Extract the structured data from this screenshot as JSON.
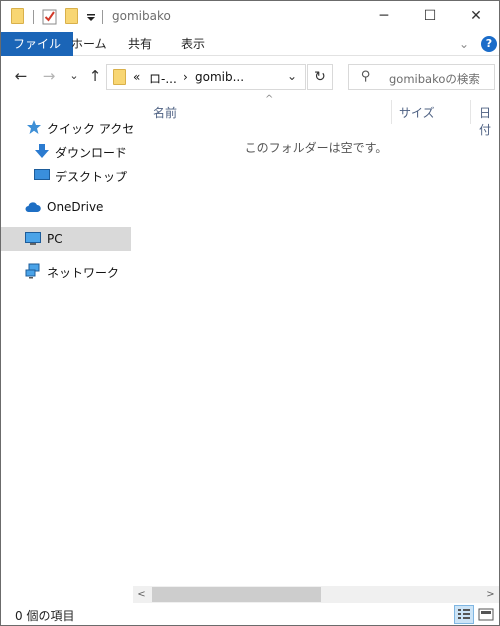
{
  "window": {
    "title": "gomibako",
    "minimize_glyph": "─",
    "maximize_glyph": "☐",
    "close_glyph": "✕"
  },
  "ribbon": {
    "tabs": [
      "ファイル",
      "ホーム",
      "共有",
      "表示"
    ],
    "expand_glyph": "⌄",
    "help_glyph": "?"
  },
  "nav": {
    "back_glyph": "←",
    "forward_glyph": "→",
    "recent_glyph": "⌄",
    "up_glyph": "↑",
    "address": {
      "overflow": "«",
      "part1": "ロ-...",
      "sep": "›",
      "part2": "gomib..."
    },
    "refresh_glyph": "↻",
    "search_placeholder": "gomibakoの検索"
  },
  "sidebar": {
    "items": [
      {
        "label": "クイック アクセス",
        "icon": "star-icon"
      },
      {
        "label": "ダウンロード",
        "icon": "download-icon",
        "pinned": true
      },
      {
        "label": "デスクトップ",
        "icon": "desktop-icon",
        "pinned": true
      },
      {
        "label": "OneDrive",
        "icon": "cloud-icon"
      },
      {
        "label": "PC",
        "icon": "pc-icon",
        "selected": true
      },
      {
        "label": "ネットワーク",
        "icon": "network-icon"
      }
    ],
    "pin_glyph": "📌"
  },
  "content": {
    "columns": [
      "名前",
      "サイズ",
      "日付"
    ],
    "sort_glyph": "^",
    "empty_message": "このフォルダーは空です。"
  },
  "scrollbar": {
    "left_glyph": "<",
    "right_glyph": ">"
  },
  "status": {
    "item_count": "0 個の項目"
  },
  "colors": {
    "accent": "#1b65b7",
    "selected_bg": "#d9d9d9",
    "column_header": "#4d6082"
  }
}
